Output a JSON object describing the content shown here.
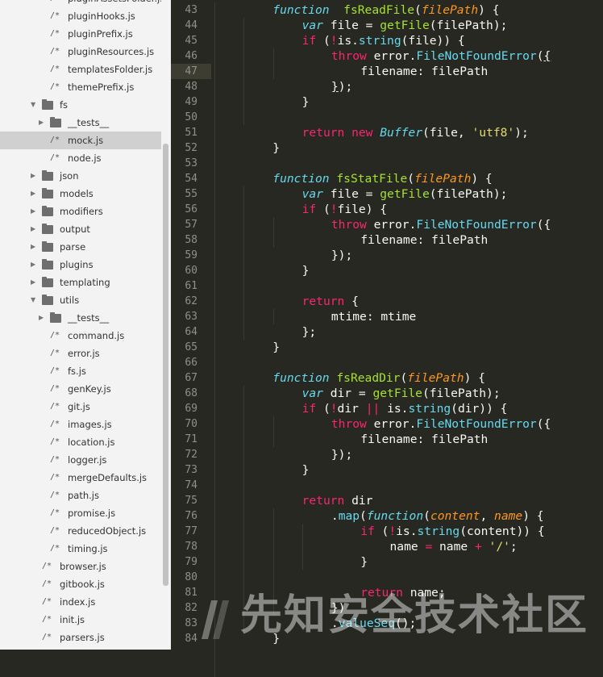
{
  "sidebar": {
    "items": [
      {
        "label": "pluginAssetsFolder.js",
        "type": "file",
        "depth": 2
      },
      {
        "label": "pluginHooks.js",
        "type": "file",
        "depth": 2
      },
      {
        "label": "pluginPrefix.js",
        "type": "file",
        "depth": 2
      },
      {
        "label": "pluginResources.js",
        "type": "file",
        "depth": 2
      },
      {
        "label": "templatesFolder.js",
        "type": "file",
        "depth": 2
      },
      {
        "label": "themePrefix.js",
        "type": "file",
        "depth": 2
      },
      {
        "label": "fs",
        "type": "folder-open",
        "depth": 1
      },
      {
        "label": "__tests__",
        "type": "folder",
        "depth": 2
      },
      {
        "label": "mock.js",
        "type": "file",
        "depth": 2,
        "selected": true
      },
      {
        "label": "node.js",
        "type": "file",
        "depth": 2
      },
      {
        "label": "json",
        "type": "folder",
        "depth": 1
      },
      {
        "label": "models",
        "type": "folder",
        "depth": 1
      },
      {
        "label": "modifiers",
        "type": "folder",
        "depth": 1
      },
      {
        "label": "output",
        "type": "folder",
        "depth": 1
      },
      {
        "label": "parse",
        "type": "folder",
        "depth": 1
      },
      {
        "label": "plugins",
        "type": "folder",
        "depth": 1
      },
      {
        "label": "templating",
        "type": "folder",
        "depth": 1
      },
      {
        "label": "utils",
        "type": "folder-open",
        "depth": 1
      },
      {
        "label": "__tests__",
        "type": "folder",
        "depth": 2
      },
      {
        "label": "command.js",
        "type": "file",
        "depth": 2
      },
      {
        "label": "error.js",
        "type": "file",
        "depth": 2
      },
      {
        "label": "fs.js",
        "type": "file",
        "depth": 2
      },
      {
        "label": "genKey.js",
        "type": "file",
        "depth": 2
      },
      {
        "label": "git.js",
        "type": "file",
        "depth": 2
      },
      {
        "label": "images.js",
        "type": "file",
        "depth": 2
      },
      {
        "label": "location.js",
        "type": "file",
        "depth": 2
      },
      {
        "label": "logger.js",
        "type": "file",
        "depth": 2
      },
      {
        "label": "mergeDefaults.js",
        "type": "file",
        "depth": 2
      },
      {
        "label": "path.js",
        "type": "file",
        "depth": 2
      },
      {
        "label": "promise.js",
        "type": "file",
        "depth": 2
      },
      {
        "label": "reducedObject.js",
        "type": "file",
        "depth": 2
      },
      {
        "label": "timing.js",
        "type": "file",
        "depth": 2
      },
      {
        "label": "browser.js",
        "type": "file",
        "depth": 1
      },
      {
        "label": "gitbook.js",
        "type": "file",
        "depth": 1
      },
      {
        "label": "index.js",
        "type": "file",
        "depth": 1
      },
      {
        "label": "init.js",
        "type": "file",
        "depth": 1
      },
      {
        "label": "parsers.js",
        "type": "file",
        "depth": 1
      }
    ]
  },
  "editor": {
    "current_line": 47,
    "lines": [
      {
        "n": 43,
        "ind": 1,
        "t": [
          [
            "kwi",
            "function"
          ],
          [
            "",
            "  "
          ],
          [
            "fn",
            "fsReadFile"
          ],
          [
            "",
            "("
          ],
          [
            "prm",
            "filePath"
          ],
          [
            "",
            ") {"
          ]
        ]
      },
      {
        "n": 44,
        "ind": 2,
        "t": [
          [
            "kwi",
            "var"
          ],
          [
            "",
            " file = "
          ],
          [
            "fn",
            "getFile"
          ],
          [
            "",
            "(filePath);"
          ]
        ]
      },
      {
        "n": 45,
        "ind": 2,
        "t": [
          [
            "kw",
            "if"
          ],
          [
            "",
            " ("
          ],
          [
            "kw",
            "!"
          ],
          [
            "",
            "is."
          ],
          [
            "sup",
            "string"
          ],
          [
            "",
            "(file)) {"
          ]
        ]
      },
      {
        "n": 46,
        "ind": 3,
        "t": [
          [
            "kw",
            "throw"
          ],
          [
            "",
            " error."
          ],
          [
            "sup",
            "FileNotFoundError"
          ],
          [
            "",
            "("
          ],
          [
            "ul",
            "{"
          ]
        ]
      },
      {
        "n": 47,
        "ind": 4,
        "t": [
          [
            "",
            "filename: filePath"
          ]
        ]
      },
      {
        "n": 48,
        "ind": 3,
        "t": [
          [
            "ul",
            "}"
          ],
          [
            "",
            ");"
          ]
        ]
      },
      {
        "n": 49,
        "ind": 2,
        "t": [
          [
            "",
            "}"
          ]
        ]
      },
      {
        "n": 50,
        "ind": 0,
        "t": []
      },
      {
        "n": 51,
        "ind": 2,
        "t": [
          [
            "kw",
            "return"
          ],
          [
            "",
            " "
          ],
          [
            "kw",
            "new"
          ],
          [
            "",
            " "
          ],
          [
            "kwi",
            "Buffer"
          ],
          [
            "",
            "(file, "
          ],
          [
            "str",
            "'utf8'"
          ],
          [
            "",
            ");"
          ]
        ]
      },
      {
        "n": 52,
        "ind": 1,
        "t": [
          [
            "",
            "}"
          ]
        ]
      },
      {
        "n": 53,
        "ind": 0,
        "t": []
      },
      {
        "n": 54,
        "ind": 1,
        "t": [
          [
            "kwi",
            "function"
          ],
          [
            "",
            " "
          ],
          [
            "fn",
            "fsStatFile"
          ],
          [
            "",
            "("
          ],
          [
            "prm",
            "filePath"
          ],
          [
            "",
            ") {"
          ]
        ]
      },
      {
        "n": 55,
        "ind": 2,
        "t": [
          [
            "kwi",
            "var"
          ],
          [
            "",
            " file = "
          ],
          [
            "fn",
            "getFile"
          ],
          [
            "",
            "(filePath);"
          ]
        ]
      },
      {
        "n": 56,
        "ind": 2,
        "t": [
          [
            "kw",
            "if"
          ],
          [
            "",
            " ("
          ],
          [
            "kw",
            "!"
          ],
          [
            "",
            "file) {"
          ]
        ]
      },
      {
        "n": 57,
        "ind": 3,
        "t": [
          [
            "kw",
            "throw"
          ],
          [
            "",
            " error."
          ],
          [
            "sup",
            "FileNotFoundError"
          ],
          [
            "",
            "({"
          ]
        ]
      },
      {
        "n": 58,
        "ind": 4,
        "t": [
          [
            "",
            "filename: filePath"
          ]
        ]
      },
      {
        "n": 59,
        "ind": 3,
        "t": [
          [
            "",
            "});"
          ]
        ]
      },
      {
        "n": 60,
        "ind": 2,
        "t": [
          [
            "",
            "}"
          ]
        ]
      },
      {
        "n": 61,
        "ind": 0,
        "t": []
      },
      {
        "n": 62,
        "ind": 2,
        "t": [
          [
            "kw",
            "return"
          ],
          [
            "",
            " {"
          ]
        ]
      },
      {
        "n": 63,
        "ind": 3,
        "t": [
          [
            "",
            "mtime: mtime"
          ]
        ]
      },
      {
        "n": 64,
        "ind": 2,
        "t": [
          [
            "",
            "};"
          ]
        ]
      },
      {
        "n": 65,
        "ind": 1,
        "t": [
          [
            "",
            "}"
          ]
        ]
      },
      {
        "n": 66,
        "ind": 0,
        "t": []
      },
      {
        "n": 67,
        "ind": 1,
        "t": [
          [
            "kwi",
            "function"
          ],
          [
            "",
            " "
          ],
          [
            "fn",
            "fsReadDir"
          ],
          [
            "",
            "("
          ],
          [
            "prm",
            "filePath"
          ],
          [
            "",
            ") {"
          ]
        ]
      },
      {
        "n": 68,
        "ind": 2,
        "t": [
          [
            "kwi",
            "var"
          ],
          [
            "",
            " dir = "
          ],
          [
            "fn",
            "getFile"
          ],
          [
            "",
            "(filePath);"
          ]
        ]
      },
      {
        "n": 69,
        "ind": 2,
        "t": [
          [
            "kw",
            "if"
          ],
          [
            "",
            " ("
          ],
          [
            "kw",
            "!"
          ],
          [
            "",
            "dir "
          ],
          [
            "kw",
            "||"
          ],
          [
            "",
            " is."
          ],
          [
            "sup",
            "string"
          ],
          [
            "",
            "(dir)) {"
          ]
        ]
      },
      {
        "n": 70,
        "ind": 3,
        "t": [
          [
            "kw",
            "throw"
          ],
          [
            "",
            " error."
          ],
          [
            "sup",
            "FileNotFoundError"
          ],
          [
            "",
            "({"
          ]
        ]
      },
      {
        "n": 71,
        "ind": 4,
        "t": [
          [
            "",
            "filename: filePath"
          ]
        ]
      },
      {
        "n": 72,
        "ind": 3,
        "t": [
          [
            "",
            "});"
          ]
        ]
      },
      {
        "n": 73,
        "ind": 2,
        "t": [
          [
            "",
            "}"
          ]
        ]
      },
      {
        "n": 74,
        "ind": 0,
        "t": []
      },
      {
        "n": 75,
        "ind": 2,
        "t": [
          [
            "kw",
            "return"
          ],
          [
            "",
            " dir"
          ]
        ]
      },
      {
        "n": 76,
        "ind": 3,
        "t": [
          [
            "",
            "."
          ],
          [
            "sup",
            "map"
          ],
          [
            "",
            "("
          ],
          [
            "kwi",
            "function"
          ],
          [
            "",
            "("
          ],
          [
            "prm",
            "content"
          ],
          [
            "",
            ", "
          ],
          [
            "prm",
            "name"
          ],
          [
            "",
            ") {"
          ]
        ]
      },
      {
        "n": 77,
        "ind": 4,
        "t": [
          [
            "kw",
            "if"
          ],
          [
            "",
            " ("
          ],
          [
            "kw",
            "!"
          ],
          [
            "",
            "is."
          ],
          [
            "sup",
            "string"
          ],
          [
            "",
            "(content)) {"
          ]
        ]
      },
      {
        "n": 78,
        "ind": 5,
        "t": [
          [
            "",
            "name "
          ],
          [
            "kw",
            "="
          ],
          [
            "",
            " name "
          ],
          [
            "kw",
            "+"
          ],
          [
            "",
            " "
          ],
          [
            "str",
            "'/'"
          ],
          [
            "",
            ";"
          ]
        ]
      },
      {
        "n": 79,
        "ind": 4,
        "t": [
          [
            "",
            "}"
          ]
        ]
      },
      {
        "n": 80,
        "ind": 0,
        "t": []
      },
      {
        "n": 81,
        "ind": 4,
        "t": [
          [
            "kw",
            "return"
          ],
          [
            "",
            " name;"
          ]
        ]
      },
      {
        "n": 82,
        "ind": 3,
        "t": [
          [
            "",
            "})"
          ]
        ]
      },
      {
        "n": 83,
        "ind": 3,
        "t": [
          [
            "",
            "."
          ],
          [
            "sup",
            "valueSeq"
          ],
          [
            "",
            "();"
          ]
        ]
      },
      {
        "n": 84,
        "ind": 1,
        "t": [
          [
            "",
            "}"
          ]
        ]
      }
    ]
  },
  "watermark": {
    "text": "先知安全技术社区"
  }
}
